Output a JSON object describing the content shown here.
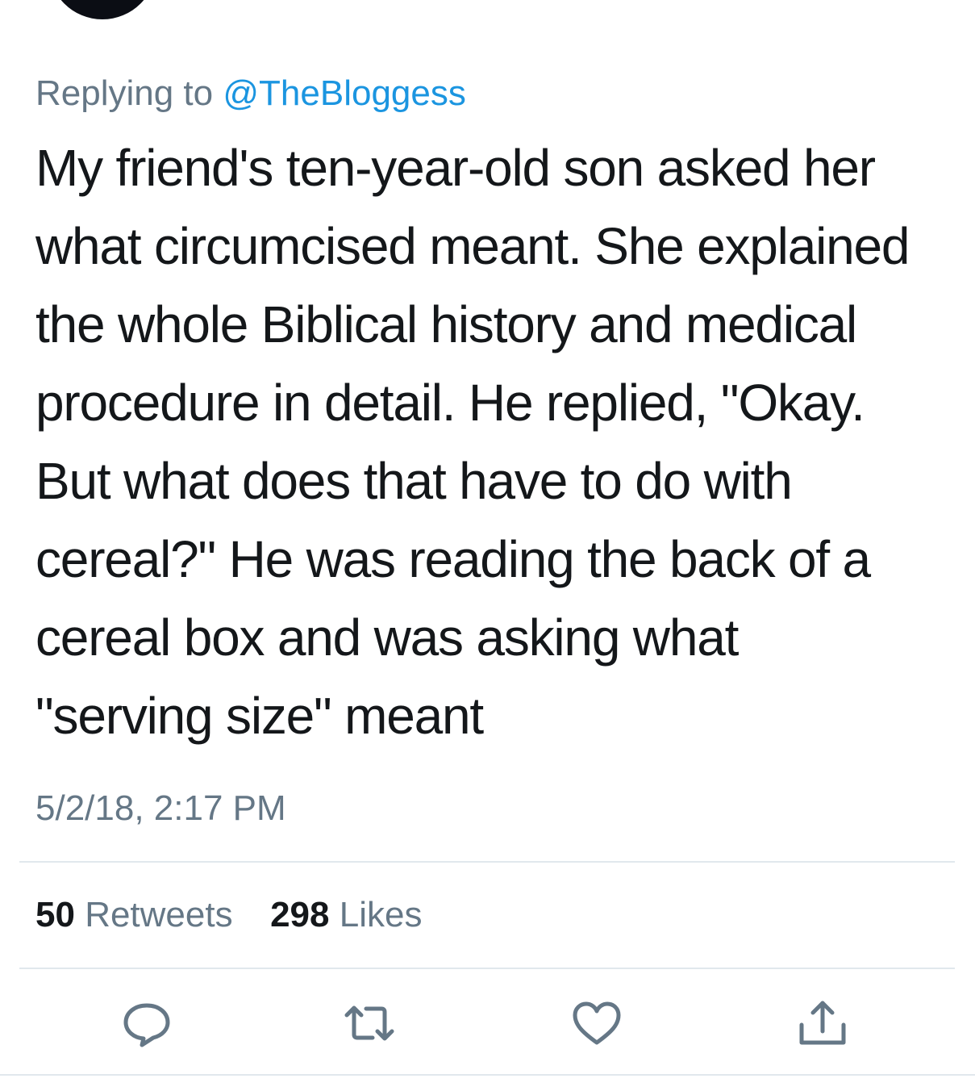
{
  "reply": {
    "prefix": "Replying to",
    "mention": "@TheBloggess"
  },
  "tweet": {
    "text": "My friend's ten-year-old son asked her\nwhat circumcised meant. She explained\nthe whole Biblical history and medical\nprocedure in detail. He replied, \"Okay.\nBut what does that have to do with\ncereal?\" He was reading the back of a\ncereal box and was asking what\n\"serving size\" meant",
    "timestamp": "5/2/18, 2:17 PM"
  },
  "stats": {
    "retweets_count": "50",
    "retweets_label": "Retweets",
    "likes_count": "298",
    "likes_label": "Likes"
  },
  "actions": {
    "icons": [
      "reply-icon",
      "retweet-icon",
      "like-icon",
      "share-icon"
    ]
  },
  "colors": {
    "text": "#14171a",
    "secondary": "#657786",
    "link": "#1b95e0",
    "divider": "#e1e8ed"
  }
}
